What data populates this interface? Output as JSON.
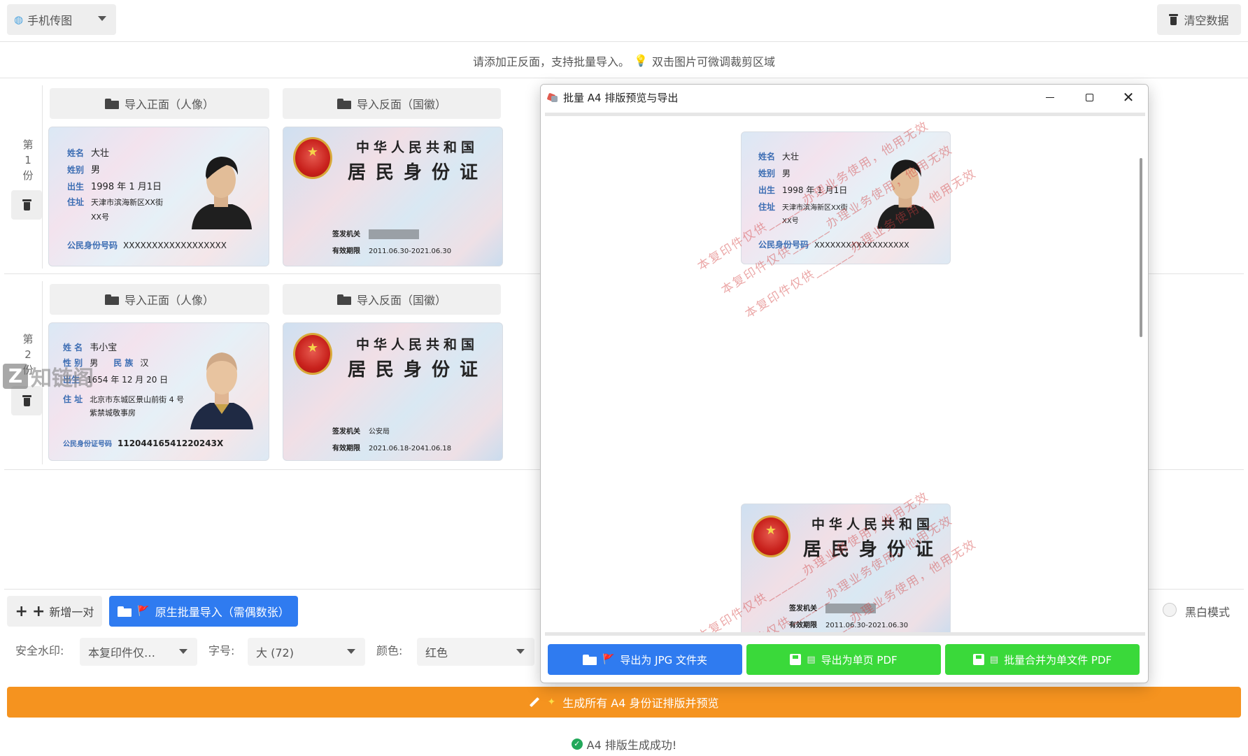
{
  "topbar": {
    "mode_label": "手机传图",
    "clear_label": "清空数据"
  },
  "hint": {
    "text_before": "请添加正反面，支持批量导入。",
    "text_after": "双击图片可微调裁剪区域"
  },
  "pairs": [
    {
      "label": [
        "第",
        "1",
        "份"
      ],
      "import_front_label": "导入正面（人像）",
      "import_back_label": "导入反面（国徽）",
      "front": {
        "name_key": "姓名",
        "name": "大壮",
        "sex_key": "姓别",
        "sex": "男",
        "ethnic_key": "",
        "ethnic": "",
        "birth_key": "出生",
        "birth": "1998 年 1 月1日",
        "addr_key": "住址",
        "addr1": "天津市滨海新区XX街",
        "addr2": "XX号",
        "id_key": "公民身份号码",
        "id": "XXXXXXXXXXXXXXXXXX"
      },
      "back": {
        "title1": "中华人民共和国",
        "title2": "居民身份证",
        "authority_key": "签发机关",
        "authority": "",
        "valid_key": "有效期限",
        "valid": "2011.06.30-2021.06.30"
      }
    },
    {
      "label": [
        "第",
        "2",
        "份"
      ],
      "import_front_label": "导入正面（人像）",
      "import_back_label": "导入反面（国徽）",
      "front": {
        "name_key": "姓 名",
        "name": "韦小宝",
        "sex_key": "性 别",
        "sex": "男",
        "ethnic_key": "民 族",
        "ethnic": "汉",
        "birth_key": "出生",
        "birth": "1654 年 12 月 20 日",
        "addr_key": "住 址",
        "addr1": "北京市东城区景山前街 4 号",
        "addr2": "紫禁城敬事房",
        "id_key": "公民身份证号码",
        "id": "11204416541220243X"
      },
      "back": {
        "title1": "中华人民共和国",
        "title2": "居民身份证",
        "authority_key": "签发机关",
        "authority": "公安局",
        "valid_key": "有效期限",
        "valid": "2021.06.18-2041.06.18"
      }
    }
  ],
  "site_watermark": "知链阁",
  "bottom": {
    "add_pair_label": "新增一对",
    "native_import_label": "原生批量导入（需偶数张）",
    "watermark_label": "安全水印:",
    "watermark_value": "本复印件仅…",
    "font_size_label": "字号:",
    "font_size_value": "大 (72)",
    "color_label": "颜色:",
    "color_value": "红色",
    "bw_mode_label": "黑白模式",
    "generate_label": "生成所有 A4 身份证排版并预览",
    "status_text": "A4 排版生成成功!"
  },
  "modal": {
    "title": "批量 A4 排版预览与导出",
    "watermark_lines": [
      "本复印件仅供______办理业务使用，他用无效",
      "本复印件仅供______办理业务使用，他用无效",
      "本复印件仅供______办理业务使用，他用无效"
    ],
    "preview_front": {
      "name_key": "姓名",
      "name": "大壮",
      "sex_key": "姓别",
      "sex": "男",
      "birth_key": "出生",
      "birth": "1998 年 1 月1日",
      "addr_key": "住址",
      "addr1": "天津市滨海新区XX街",
      "addr2": "XX号",
      "id_key": "公民身份号码",
      "id": "XXXXXXXXXXXXXXXXXX"
    },
    "preview_back": {
      "title1": "中华人民共和国",
      "title2": "居民身份证",
      "authority_key": "签发机关",
      "valid_key": "有效期限",
      "valid": "2011.06.30-2021.06.30"
    },
    "export_jpg_label": "导出为 JPG 文件夹",
    "export_single_label": "导出为单页 PDF",
    "export_merge_label": "批量合并为单文件 PDF"
  },
  "colors": {
    "accent_blue": "#2f7bf0",
    "accent_green": "#3ad93a",
    "accent_orange": "#f5931f",
    "watermark_red": "#d23c3c"
  },
  "icons": [
    "globe-icon",
    "trash-icon",
    "bulb-icon",
    "folder-icon",
    "flag-icon",
    "plus-icon",
    "pencil-icon",
    "sparkle-icon",
    "check-icon",
    "save-icon",
    "pages-icon",
    "emblem-icon"
  ]
}
